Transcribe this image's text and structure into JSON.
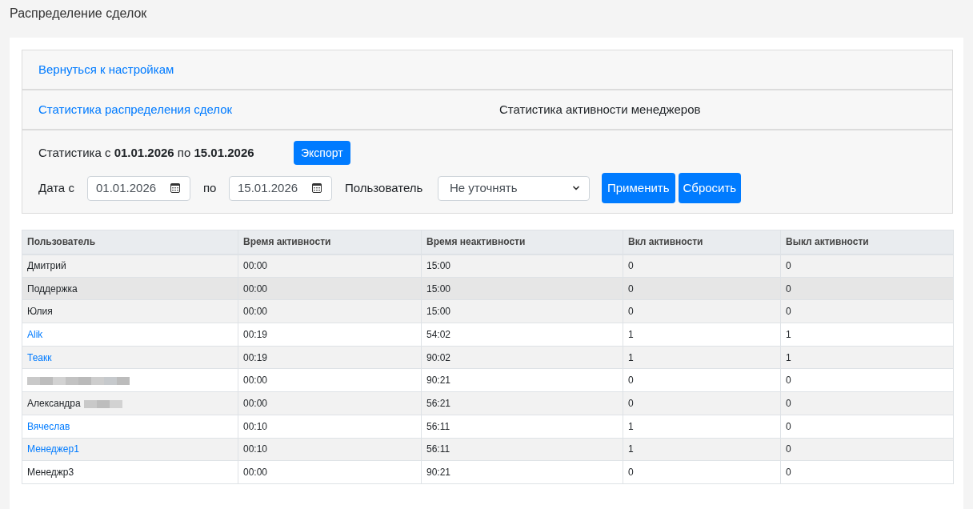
{
  "page_title": "Распределение сделок",
  "back_link": "Вернуться к настройкам",
  "tabs": [
    {
      "label": "Статистика распределения сделок",
      "selected": false
    },
    {
      "label": "Статистика активности менеджеров",
      "selected": true
    }
  ],
  "summary": "Статистика с **01.01.2026** по **15.01.2026**",
  "export_button": "Экспорт",
  "filters": {
    "date_from": {
      "label": "Дата с",
      "value": "01.01.2026"
    },
    "date_to": {
      "label": "по",
      "value": "15.01.2026"
    },
    "user": {
      "label": "Пользователь",
      "value": "Не уточнять"
    }
  },
  "buttons": [
    "Применить",
    "Сбросить"
  ],
  "table": {
    "columns": [
      "Пользователь",
      "Время активности",
      "Время неактивности",
      "Вкл активности",
      "Выкл активности"
    ],
    "rows": [
      {
        "user": "Дмитрий",
        "link": false,
        "redacted": false,
        "highlighted": false,
        "active_time": "00:00",
        "inactive_time": "15:00",
        "on_count": "0",
        "off_count": "0"
      },
      {
        "user": "Поддержка",
        "link": false,
        "redacted": false,
        "highlighted": true,
        "active_time": "00:00",
        "inactive_time": "15:00",
        "on_count": "0",
        "off_count": "0"
      },
      {
        "user": "Юлия",
        "link": false,
        "redacted": false,
        "highlighted": false,
        "active_time": "00:00",
        "inactive_time": "15:00",
        "on_count": "0",
        "off_count": "0"
      },
      {
        "user": "Alik",
        "link": true,
        "redacted": false,
        "highlighted": false,
        "active_time": "00:19",
        "inactive_time": "54:02",
        "on_count": "1",
        "off_count": "1"
      },
      {
        "user": "Теакк",
        "link": true,
        "redacted": false,
        "highlighted": false,
        "active_time": "00:19",
        "inactive_time": "90:02",
        "on_count": "1",
        "off_count": "1"
      },
      {
        "redacted": true,
        "highlighted": false,
        "active_time": "00:00",
        "inactive_time": "90:21",
        "on_count": "0",
        "off_count": "0"
      },
      {
        "user": "Александра",
        "link": false,
        "redacted": true,
        "highlighted": false,
        "active_time": "00:00",
        "inactive_time": "56:21",
        "on_count": "0",
        "off_count": "0"
      },
      {
        "user": "Вячеслав",
        "link": true,
        "redacted": false,
        "highlighted": false,
        "active_time": "00:10",
        "inactive_time": "56:11",
        "on_count": "1",
        "off_count": "0"
      },
      {
        "user": "Менеджер1",
        "link": true,
        "redacted": false,
        "highlighted": false,
        "active_time": "00:10",
        "inactive_time": "56:11",
        "on_count": "1",
        "off_count": "0"
      },
      {
        "user": "Менеджр3",
        "link": false,
        "redacted": false,
        "highlighted": false,
        "active_time": "00:00",
        "inactive_time": "90:21",
        "on_count": "0",
        "off_count": "0"
      }
    ]
  }
}
